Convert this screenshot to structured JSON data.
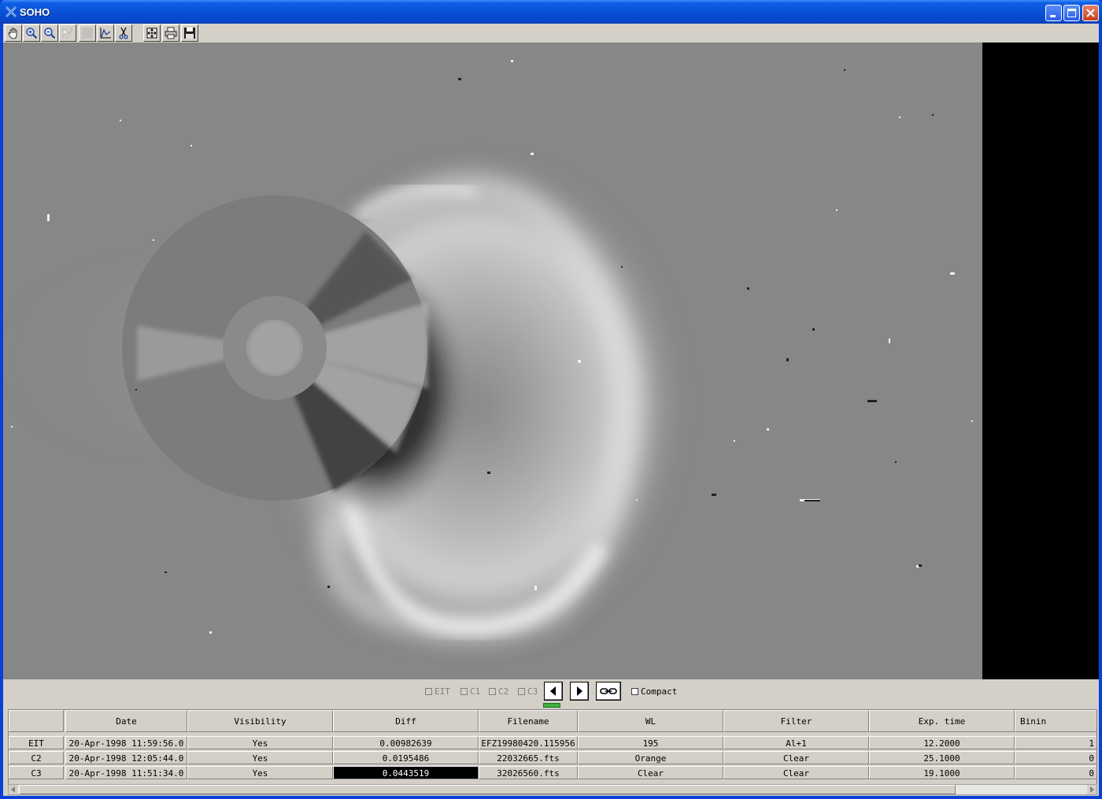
{
  "window": {
    "title": "SOHO"
  },
  "toolbar": {
    "buttons": [
      "pan-hand-icon",
      "zoom-in-icon",
      "zoom-out-icon",
      "help-query-icon",
      "blank-icon",
      "plot-icon",
      "cut-icon",
      "fit-view-icon",
      "print-icon",
      "save-icon"
    ]
  },
  "navbar": {
    "checkboxes": [
      {
        "label": "EIT",
        "checked": false
      },
      {
        "label": "C1",
        "checked": false
      },
      {
        "label": "C2",
        "checked": false
      },
      {
        "label": "C3",
        "checked": false
      }
    ],
    "compact_label": "Compact"
  },
  "table": {
    "columns": [
      "",
      "Date",
      "Visibility",
      "Diff",
      "Filename",
      "WL",
      "Filter",
      "Exp. time",
      "Binin"
    ],
    "rows": [
      [
        "EIT",
        "20-Apr-1998 11:59:56.0",
        "Yes",
        "0.00982639",
        "EFZ19980420.115956",
        "195",
        "Al+1",
        "12.2000",
        "1"
      ],
      [
        "C2",
        "20-Apr-1998 12:05:44.0",
        "Yes",
        "0.0195486",
        "22032665.fts",
        "Orange",
        "Clear",
        "25.1000",
        "0"
      ],
      [
        "C3",
        "20-Apr-1998 11:51:34.0",
        "Yes",
        "0.0443519",
        "32026560.fts",
        "Clear",
        "Clear",
        "19.1000",
        "0"
      ]
    ],
    "selected_cell": {
      "row": 2,
      "col": 3
    }
  },
  "colors": {
    "titlebar": "#0a50d8",
    "sky_background": "#878787",
    "panel": "#d4d0c8"
  }
}
